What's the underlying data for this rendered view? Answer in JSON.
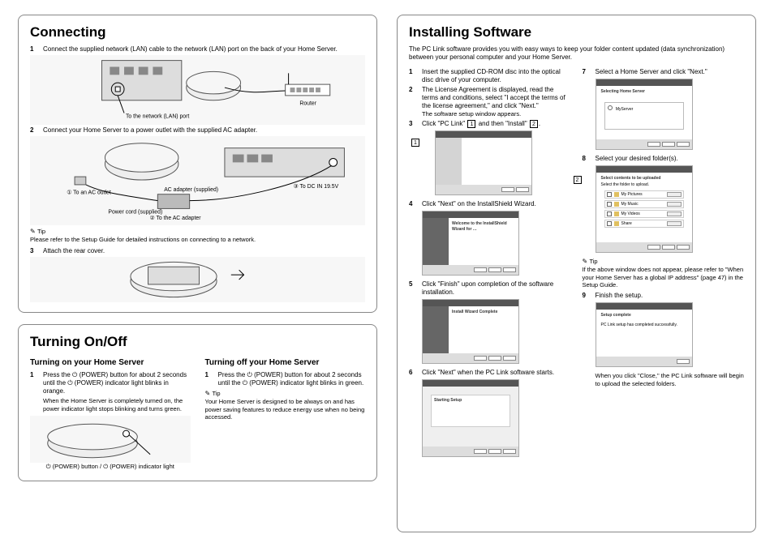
{
  "left": {
    "connecting": {
      "title": "Connecting",
      "steps": {
        "s1": {
          "num": "1",
          "text": "Connect the supplied network (LAN) cable to the network (LAN) port on the back of your Home Server."
        },
        "s2": {
          "num": "2",
          "text": "Connect your Home Server to a power outlet with the supplied AC adapter."
        },
        "s3": {
          "num": "3",
          "text": "Attach the rear cover."
        }
      },
      "labels": {
        "lan_port": "To the network (LAN) port",
        "router": "Router",
        "ac_outlet": "① To an AC outlet",
        "power_cord": "Power cord (supplied)",
        "to_ac_adapter": "② To the AC adapter",
        "ac_adapter": "AC adapter (supplied)",
        "dc_in": "③ To DC IN 19.5V"
      },
      "tip_label": "Tip",
      "tip_text": "Please refer to the Setup Guide for detailed instructions on connecting to a network."
    },
    "power": {
      "title": "Turning On/Off",
      "on": {
        "heading": "Turning on your Home Server",
        "s1_num": "1",
        "s1_text": "Press the ⏻ (POWER) button for about 2 seconds until the ⏻ (POWER) indicator light blinks in orange.",
        "s1_note": "When the Home Server is completely turned on, the power indicator light stops blinking and turns green."
      },
      "off": {
        "heading": "Turning off your Home Server",
        "s1_num": "1",
        "s1_text": "Press the ⏻ (POWER) button for about 2 seconds until the ⏻ (POWER) indicator light blinks in green.",
        "tip_label": "Tip",
        "tip_text": "Your Home Server is designed to be always on and has power saving features to reduce energy use when no being accessed."
      },
      "caption": "⏻ (POWER) button / ⏻ (POWER) indicator light"
    }
  },
  "right": {
    "title": "Installing Software",
    "intro": "The PC Link software provides you with easy ways to keep your folder content updated (data synchronization) between your personal computer and your Home Server.",
    "colA": {
      "s1": {
        "num": "1",
        "text": "Insert the supplied CD-ROM disc into the optical disc drive of your computer."
      },
      "s2": {
        "num": "2",
        "text": "The License Agreement is displayed, read the terms and conditions, select \"I accept the terms of the license agreement,\" and click \"Next.\"",
        "after": "The software setup window appears."
      },
      "s3": {
        "num": "3",
        "text_a": "Click \"PC Link\"",
        "text_b": "and then \"Install\"",
        "text_c": "."
      },
      "s4": {
        "num": "4",
        "text": "Click \"Next\" on the InstallShield Wizard."
      },
      "s5": {
        "num": "5",
        "text": "Click \"Finish\" upon completion of the software installation."
      },
      "s6": {
        "num": "6",
        "text": "Click \"Next\" when the PC Link software starts."
      }
    },
    "colB": {
      "s7": {
        "num": "7",
        "text": "Select a Home Server and click \"Next.\""
      },
      "s8": {
        "num": "8",
        "text": "Select your desired folder(s)."
      },
      "tip_label": "Tip",
      "tip_text": "If the above window does not appear, please refer to \"When your Home Server has a global IP address\" (page 47) in the Setup Guide.",
      "s9": {
        "num": "9",
        "text": "Finish the setup."
      },
      "closing": "When you click \"Close,\" the PC Link software will begin to upload the selected folders."
    },
    "screenshots": {
      "sc3": {
        "callout1": "1",
        "callout2": "2"
      },
      "sc4_title": "Welcome to the InstallShield Wizard for …",
      "sc5_title": "Install Wizard Complete",
      "sc6_title": "Starting Setup",
      "sc7_title": "Selecting Home Server",
      "sc7_item": "MyServer",
      "sc8_title": "Select contents to be uploaded",
      "sc8_sub": "Select the folder to upload.",
      "sc8_rows": [
        "My Pictures",
        "My Music",
        "My Videos",
        "Share"
      ],
      "sc9_title": "Setup complete",
      "sc9_body": "PC Link setup has completed successfully."
    }
  }
}
